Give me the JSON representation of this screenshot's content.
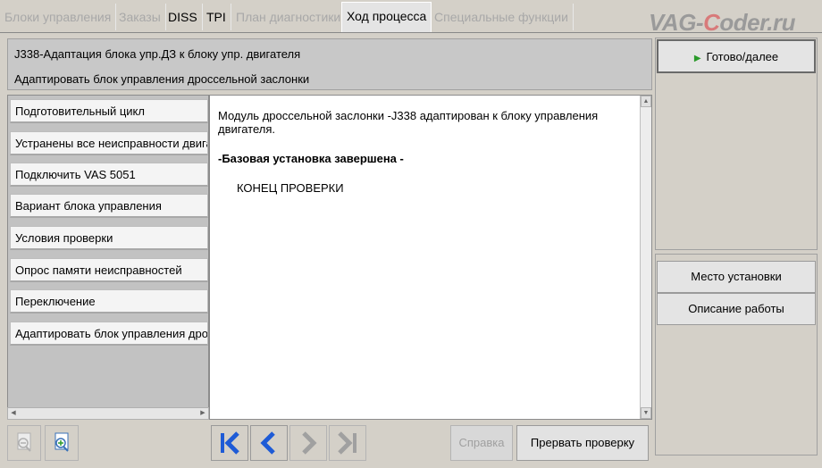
{
  "tabs": [
    {
      "label": "Блоки управления",
      "enabled": false
    },
    {
      "label": "Заказы",
      "enabled": false
    },
    {
      "label": "DISS",
      "enabled": true
    },
    {
      "label": "TPI",
      "enabled": true
    },
    {
      "label": "План диагностики",
      "enabled": false
    },
    {
      "label": "Ход процесса",
      "enabled": true,
      "active": true
    },
    {
      "label": "Специальные функции",
      "enabled": false
    }
  ],
  "brand": {
    "part1": "VAG-",
    "part2": "C",
    "part3": "oder.ru"
  },
  "header": {
    "line1": "J338-Адаптация блока упр.ДЗ к блоку упр. двигателя",
    "line2": "Адаптировать блок управления дроссельной заслонки"
  },
  "steps": [
    "Подготовительный цикл",
    "Устранены все неисправности двигателя",
    "Подключить VAS 5051",
    "Вариант блока управления",
    "Условия проверки",
    "Опрос памяти неисправностей",
    "Переключение",
    "Адаптировать блок управления дроссельной заслонки"
  ],
  "content": {
    "text1": "Модуль дроссельной заслонки -J338 адаптирован к блоку управления двигателя.",
    "text2": "-Базовая установка завершена -",
    "text3": "КОНЕЦ ПРОВЕРКИ"
  },
  "right": {
    "ready": "Готово/далее",
    "location": "Место установки",
    "description": "Описание работы"
  },
  "bottom": {
    "help": "Справка",
    "abort": "Прервать проверку"
  },
  "colors": {
    "nav_blue": "#1e5bd6",
    "ready_green": "#2a9a2a",
    "disabled": "#a8a8a8"
  }
}
